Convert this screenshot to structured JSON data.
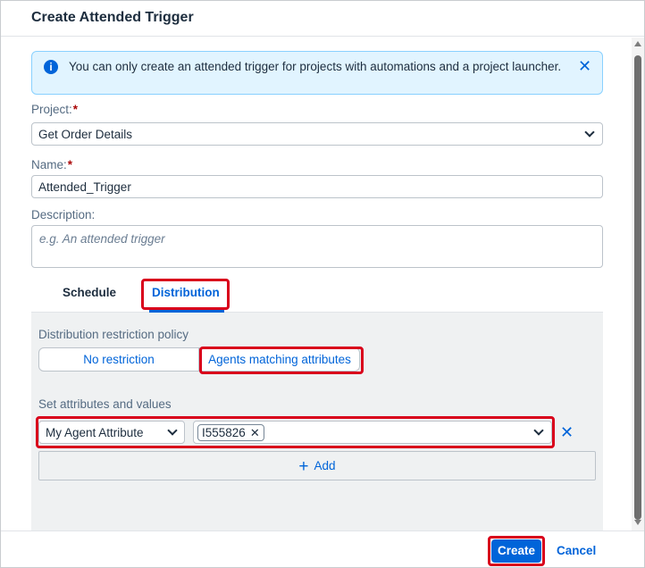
{
  "dialog": {
    "title": "Create Attended Trigger"
  },
  "info": {
    "text": "You can only create an attended trigger for projects with automations and a project launcher.",
    "icon": "info-icon",
    "close_icon": "close-icon"
  },
  "project": {
    "label": "Project:",
    "required_mark": "*",
    "value": "Get Order Details"
  },
  "name": {
    "label": "Name:",
    "required_mark": "*",
    "value": "Attended_Trigger"
  },
  "description": {
    "label": "Description:",
    "placeholder": "e.g. An attended trigger"
  },
  "tabs": [
    {
      "label": "Schedule",
      "selected": false
    },
    {
      "label": "Distribution",
      "selected": true
    }
  ],
  "distribution": {
    "policy_label": "Distribution restriction policy",
    "options": [
      "No restriction",
      "Agents matching attributes"
    ],
    "selected_option": "Agents matching attributes",
    "attributes_label": "Set attributes and values",
    "attribute": "My Agent Attribute",
    "value_tokens": [
      "I555826"
    ],
    "add_label": "Add"
  },
  "footer": {
    "create_label": "Create",
    "cancel_label": "Cancel"
  },
  "colors": {
    "accent": "#0064d9",
    "highlight": "#d9001b",
    "required": "#aa0808",
    "info_bg": "#e1f4ff"
  }
}
